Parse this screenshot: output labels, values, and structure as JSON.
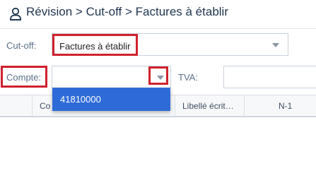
{
  "header": {
    "icon": "user-icon",
    "title": "Révision > Cut-off > Factures à établir"
  },
  "filters": {
    "cutoff_label": "Cut-off:",
    "cutoff_value": "Factures à établir",
    "compte_label": "Compte:",
    "compte_value": "",
    "tva_label": "TVA:",
    "tva_value": ""
  },
  "dropdown": {
    "options": [
      "41810000"
    ]
  },
  "grid": {
    "columns": [
      "Co",
      "Libellé écrit…",
      "N-1"
    ]
  },
  "colors": {
    "highlight": "#d0212d",
    "selected_option": "#2f6bd8"
  }
}
